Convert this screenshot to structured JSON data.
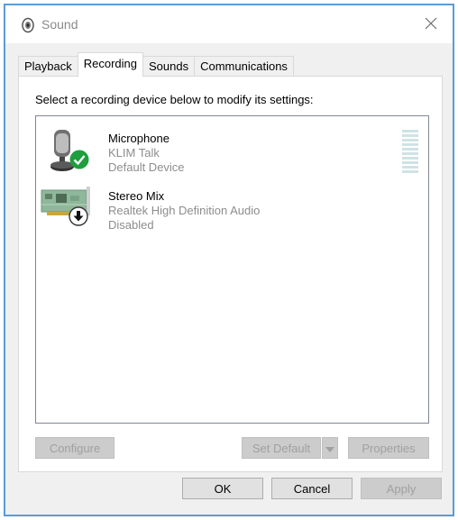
{
  "window": {
    "title": "Sound",
    "icon": "speaker-icon",
    "close_icon": "close-icon"
  },
  "tabs": [
    {
      "label": "Playback",
      "active": false
    },
    {
      "label": "Recording",
      "active": true
    },
    {
      "label": "Sounds",
      "active": false
    },
    {
      "label": "Communications",
      "active": false
    }
  ],
  "panel": {
    "instruction": "Select a recording device below to modify its settings:"
  },
  "devices": [
    {
      "name": "Microphone",
      "description": "KLIM Talk",
      "status": "Default Device",
      "icon": "microphone-icon",
      "badge": "default-check-icon",
      "badge_color": "#1e9e3e"
    },
    {
      "name": "Stereo Mix",
      "description": "Realtek High Definition Audio",
      "status": "Disabled",
      "icon": "sound-card-icon",
      "badge": "disabled-arrow-icon"
    }
  ],
  "buttons": {
    "configure": "Configure",
    "set_default": "Set Default",
    "properties": "Properties",
    "ok": "OK",
    "cancel": "Cancel",
    "apply": "Apply"
  },
  "colors": {
    "accent_border": "#5b9bd5",
    "meter": "#cfe3e3"
  }
}
